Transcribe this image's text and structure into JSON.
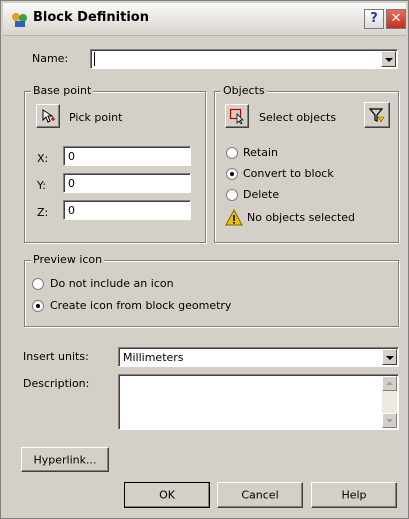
{
  "window": {
    "title": "Block Definition",
    "help_glyph": "?",
    "close_glyph": "✕"
  },
  "name": {
    "label": "Name:",
    "value": ""
  },
  "base_point": {
    "group_title": "Base point",
    "pick_point_label": "Pick point",
    "x_label": "X:",
    "x_value": "0",
    "y_label": "Y:",
    "y_value": "0",
    "z_label": "Z:",
    "z_value": "0"
  },
  "objects": {
    "group_title": "Objects",
    "select_objects_label": "Select objects",
    "retain_label": "Retain",
    "convert_label": "Convert to block",
    "delete_label": "Delete",
    "selected_option": "convert",
    "warning_text": "No objects selected"
  },
  "preview": {
    "group_title": "Preview icon",
    "no_icon_label": "Do not include an icon",
    "create_icon_label": "Create icon from block geometry",
    "selected_option": "create"
  },
  "insert_units": {
    "label": "Insert units:",
    "value": "Millimeters"
  },
  "description": {
    "label": "Description:",
    "value": ""
  },
  "buttons": {
    "hyperlink": "Hyperlink...",
    "ok": "OK",
    "cancel": "Cancel",
    "help": "Help"
  },
  "colors": {
    "dialog_bg": "#d4d0c8",
    "close_red": "#c03020",
    "warning_yellow": "#f0c000"
  }
}
